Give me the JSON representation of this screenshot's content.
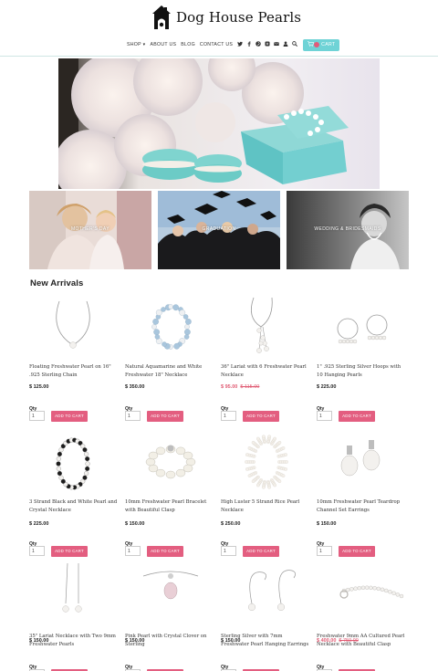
{
  "brand": {
    "name": "Dog House Pearls"
  },
  "nav": {
    "items": [
      "SHOP",
      "ABOUT US",
      "BLOG",
      "CONTACT US"
    ],
    "shop_caret": "▾",
    "cart_label": "CART",
    "icons": [
      "twitter-icon",
      "facebook-icon",
      "pinterest-icon",
      "instagram-icon",
      "email-icon",
      "account-icon",
      "search-icon"
    ]
  },
  "categories": [
    {
      "label": "MOTHER'S DAY"
    },
    {
      "label": "GRADUATION"
    },
    {
      "label": "WEDDING & BRIDESMAIDS"
    }
  ],
  "section": {
    "title": "New Arrivals"
  },
  "common": {
    "qty_label": "Qty",
    "qty_value": "1",
    "add_label": "ADD TO CART"
  },
  "products": [
    {
      "name": "Floating Freshwater Pearl on 16\" .925 Sterling Chain",
      "price": "$ 125.00",
      "sale": false,
      "icon": "pearl-necklace-icon"
    },
    {
      "name": "Natural Aquamarine and White Freshwater 18\" Necklace",
      "price": "$ 350.00",
      "sale": false,
      "icon": "aquamarine-necklace-icon"
    },
    {
      "name": "36\" Lariat with 6 Freshwater Pearl Necklace",
      "price": "$ 95.00",
      "old_price": "$ 115.00",
      "sale": true,
      "icon": "lariat-necklace-icon"
    },
    {
      "name": "1\" .925 Sterling Silver Hoops with 10 Hanging Pearls",
      "price": "$ 225.00",
      "sale": false,
      "icon": "hoop-earrings-icon"
    },
    {
      "name": "3 Strand Black and White Pearl and Crystal Necklace",
      "price": "$ 225.00",
      "sale": false,
      "icon": "black-white-necklace-icon"
    },
    {
      "name": "10mm Freshwater Pearl Bracelet with Beautiful Clasp",
      "price": "$ 150.00",
      "sale": false,
      "icon": "pearl-bracelet-icon"
    },
    {
      "name": "High Luster 5 Strand Rice Pearl Necklace",
      "price": "$ 250.00",
      "sale": false,
      "icon": "rice-pearl-necklace-icon"
    },
    {
      "name": "10mm Freshwater Pearl Teardrop Channel Set Earrings",
      "price": "$ 150.00",
      "sale": false,
      "icon": "teardrop-earrings-icon"
    },
    {
      "name": "35\" Lariat Necklace with Two 9mm Freshwater Pearls",
      "price": "$ 150.00",
      "sale": false,
      "icon": "lariat-two-pearls-icon"
    },
    {
      "name": "Pink Pearl with Crystal Clover on Sterling",
      "price": "$ 150.00",
      "sale": false,
      "icon": "pink-pearl-pendant-icon"
    },
    {
      "name": "Sterling Silver with 7mm Freshwater Pearl Hanging Earrings",
      "price": "$ 150.00",
      "sale": false,
      "icon": "hanging-earrings-icon"
    },
    {
      "name": "Freshwater 9mm AA Cultured Pearl Necklace with Beautiful Clasp",
      "price": "$ 400.00",
      "old_price": "$ 750.00",
      "sale": true,
      "icon": "strand-necklace-icon"
    }
  ],
  "colors": {
    "accent": "#e35e80",
    "cart": "#6fd3d6",
    "sale": "#e05b73",
    "rule": "#cfe6e4"
  }
}
